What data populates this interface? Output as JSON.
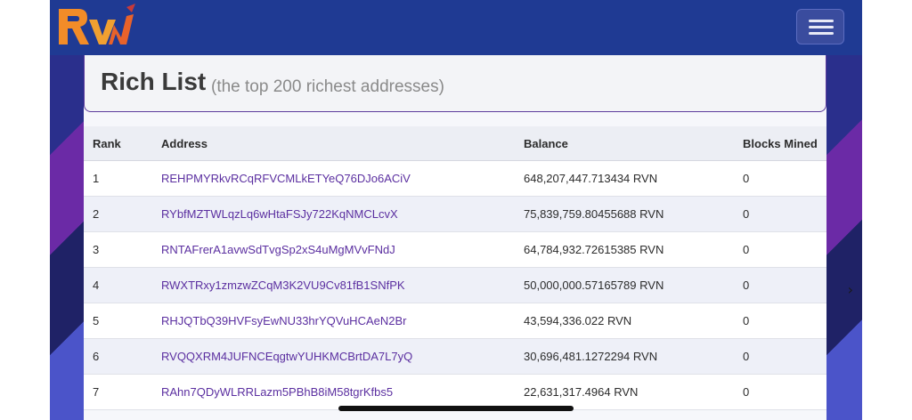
{
  "header": {
    "logo_text": "RVN",
    "menu_icon": "hamburger-menu-icon"
  },
  "page": {
    "title": "Rich List",
    "subtitle": "(the top 200 richest addresses)"
  },
  "table": {
    "columns": [
      "Rank",
      "Address",
      "Balance",
      "Blocks Mined"
    ],
    "rows": [
      {
        "rank": "1",
        "address": "REHPMYRkvRCqRFVCMLkETYeQ76DJo6ACiV",
        "balance": "648,207,447.713434 RVN",
        "blocks": "0"
      },
      {
        "rank": "2",
        "address": "RYbfMZTWLqzLq6wHtaFSJy722KqNMCLcvX",
        "balance": "75,839,759.80455688 RVN",
        "blocks": "0"
      },
      {
        "rank": "3",
        "address": "RNTAFrerA1avwSdTvgSp2xS4uMgMVvFNdJ",
        "balance": "64,784,932.72615385 RVN",
        "blocks": "0"
      },
      {
        "rank": "4",
        "address": "RWXTRxy1zmzwZCqM3K2VU9Cv81fB1SNfPK",
        "balance": "50,000,000.57165789 RVN",
        "blocks": "0"
      },
      {
        "rank": "5",
        "address": "RHJQTbQ39HVFsyEwNU33hrYQVuHCAeN2Br",
        "balance": "43,594,336.022 RVN",
        "blocks": "0"
      },
      {
        "rank": "6",
        "address": "RVQQXRM4JUFNCEqgtwYUHKMCBrtDA7L7yQ",
        "balance": "30,696,481.1272294 RVN",
        "blocks": "0"
      },
      {
        "rank": "7",
        "address": "RAhn7QDyWLRRLazm5PBhB8iM58tgrKfbs5",
        "balance": "22,631,317.4964 RVN",
        "blocks": "0"
      }
    ]
  },
  "colors": {
    "header_bg": "#1f3a93",
    "link": "#5b2fa0",
    "title_border": "#5b3a9c"
  }
}
